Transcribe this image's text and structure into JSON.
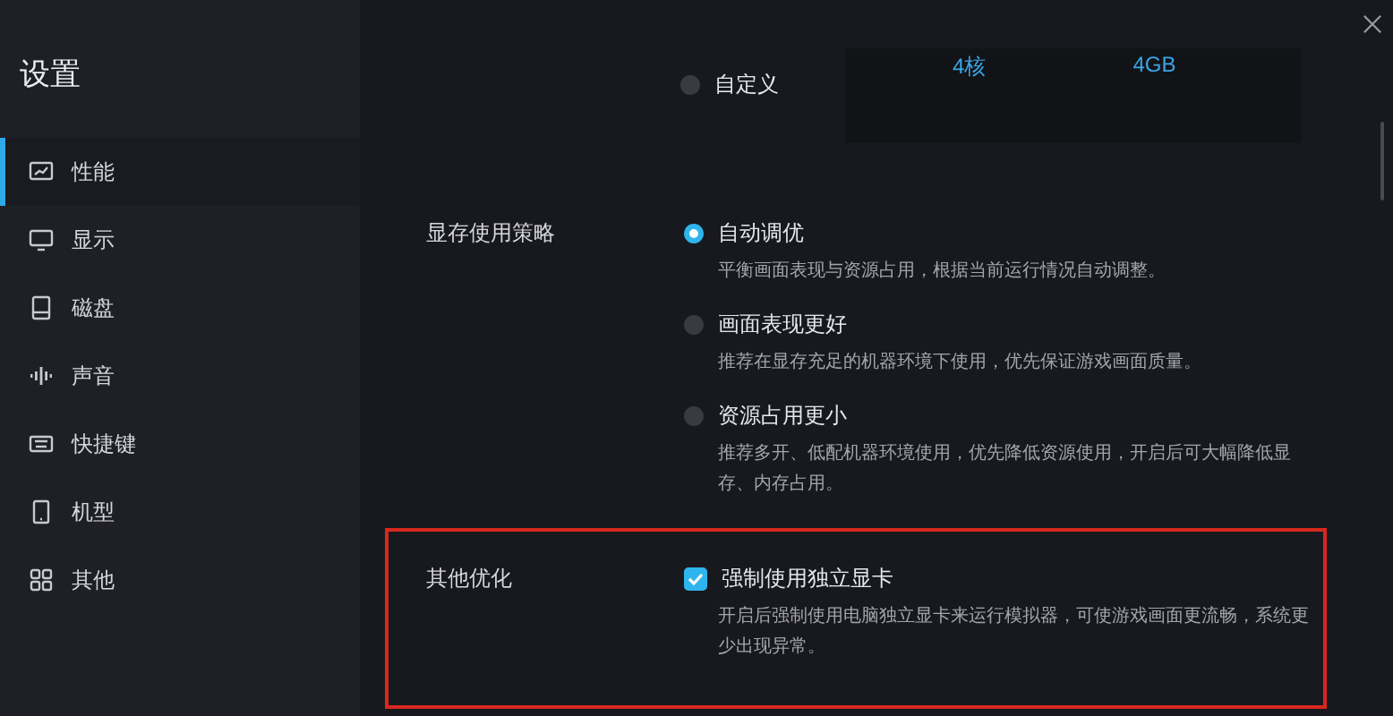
{
  "sidebar": {
    "title": "设置",
    "items": [
      {
        "label": "性能",
        "selected": true
      },
      {
        "label": "显示",
        "selected": false
      },
      {
        "label": "磁盘",
        "selected": false
      },
      {
        "label": "声音",
        "selected": false
      },
      {
        "label": "快捷键",
        "selected": false
      },
      {
        "label": "机型",
        "selected": false
      },
      {
        "label": "其他",
        "selected": false
      }
    ]
  },
  "custom_option": {
    "label": "自定义",
    "selected": false,
    "values": [
      "4核",
      "4GB"
    ]
  },
  "sections": [
    {
      "label": "显存使用策略",
      "highlighted": false,
      "options": [
        {
          "kind": "radio",
          "label": "自动调优",
          "selected": true,
          "description": "平衡画面表现与资源占用，根据当前运行情况自动调整。"
        },
        {
          "kind": "radio",
          "label": "画面表现更好",
          "selected": false,
          "description": "推荐在显存充足的机器环境下使用，优先保证游戏画面质量。"
        },
        {
          "kind": "radio",
          "label": "资源占用更小",
          "selected": false,
          "description": "推荐多开、低配机器环境使用，优先降低资源使用，开启后可大幅降低显存、内存占用。"
        }
      ]
    },
    {
      "label": "其他优化",
      "highlighted": true,
      "options": [
        {
          "kind": "checkbox",
          "label": "强制使用独立显卡",
          "checked": true,
          "description": "开启后强制使用电脑独立显卡来运行模拟器，可使游戏画面更流畅，系统更少出现异常。"
        }
      ]
    }
  ]
}
